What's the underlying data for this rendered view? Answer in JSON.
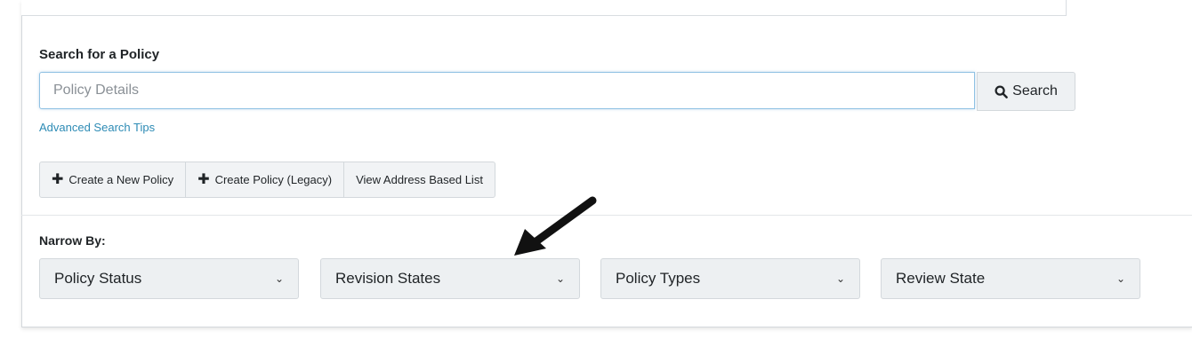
{
  "search": {
    "heading": "Search for a Policy",
    "placeholder": "Policy Details",
    "button_label": "Search",
    "advanced_tips_label": "Advanced Search Tips"
  },
  "actions": [
    {
      "label": "Create a New Policy",
      "icon": "plus-icon"
    },
    {
      "label": "Create Policy (Legacy)",
      "icon": "plus-icon"
    },
    {
      "label": "View Address Based List"
    }
  ],
  "narrow_by": {
    "label": "Narrow By:",
    "filters": [
      {
        "label": "Policy Status"
      },
      {
        "label": "Revision States"
      },
      {
        "label": "Policy Types"
      },
      {
        "label": "Review State"
      }
    ]
  },
  "colors": {
    "link": "#2d8bb5",
    "input_focus_border": "#8fc1e3",
    "button_bg": "#eef1f3",
    "annotation_arrow": "#111111"
  }
}
